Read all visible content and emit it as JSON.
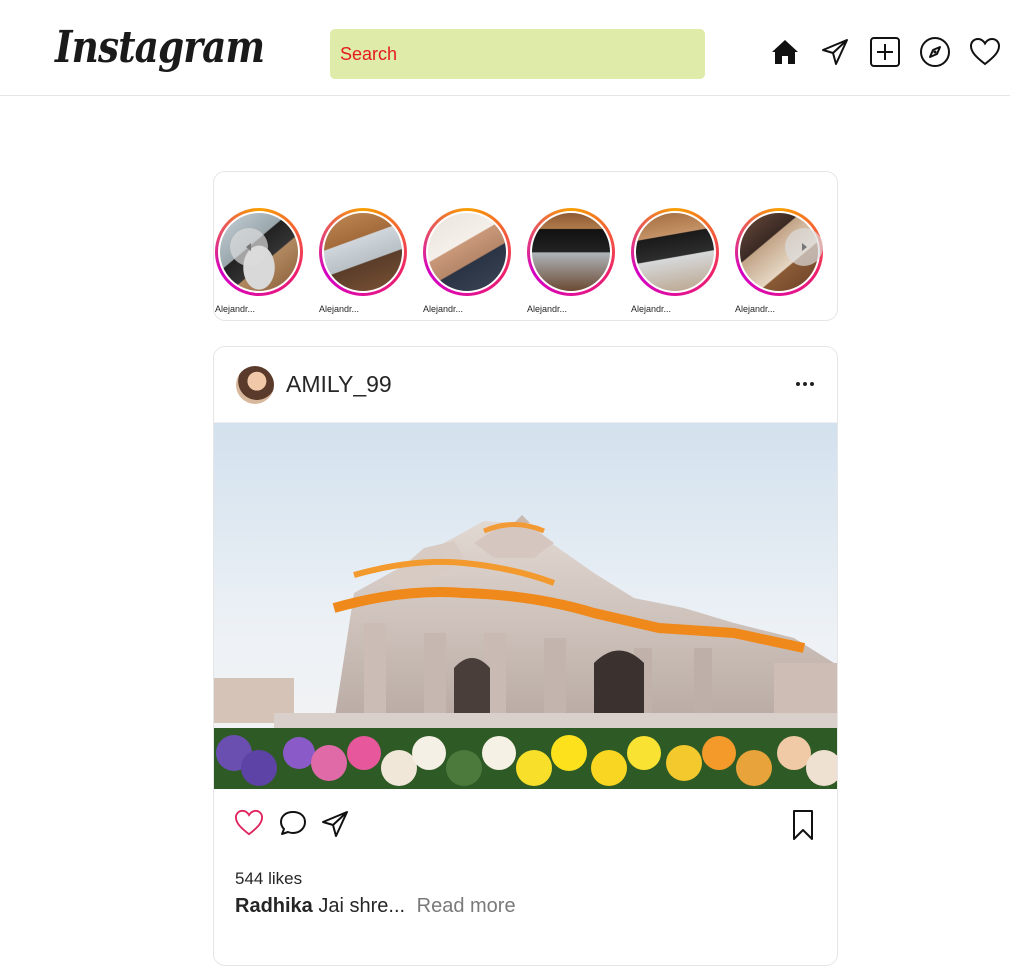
{
  "app": {
    "logo_text": "Instagram"
  },
  "search": {
    "placeholder": "Search",
    "value": ""
  },
  "nav_icons": [
    "home-icon",
    "direct-message-icon",
    "create-post-icon",
    "explore-icon",
    "notifications-heart-icon"
  ],
  "stories": {
    "items": [
      {
        "name": "Alejandr..."
      },
      {
        "name": "Alejandr..."
      },
      {
        "name": "Alejandr..."
      },
      {
        "name": "Alejandr..."
      },
      {
        "name": "Alejandr..."
      },
      {
        "name": "Alejandr..."
      }
    ],
    "prev_icon": "chevron-left-icon",
    "next_icon": "chevron-right-icon"
  },
  "post": {
    "username": "AMILY_99",
    "more_icon": "more-options-icon",
    "likes_text": "544 likes",
    "caption_user": "Radhika",
    "caption_text": "Jai shre...",
    "read_more": "Read more"
  },
  "colors": {
    "search_bg": "#dfeba8",
    "search_text": "#e51b1b",
    "like_outline": "#e0245e",
    "story_ring_start": "#f9a000",
    "story_ring_end": "#d300c5"
  }
}
